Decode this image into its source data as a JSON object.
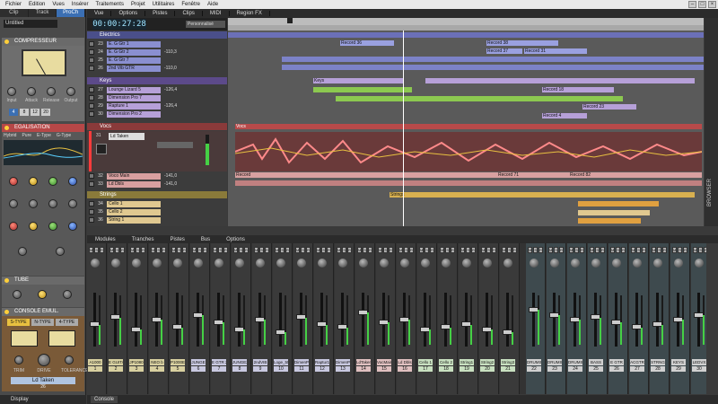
{
  "menubar": {
    "items": [
      "Fichier",
      "Edition",
      "Vues",
      "Insérer",
      "Traitements",
      "Projet",
      "Utilitaires",
      "Fenêtre",
      "Aide"
    ]
  },
  "inspector": {
    "tabs": [
      "Clip",
      "Track",
      "ProCh"
    ],
    "project_name": "Untitled",
    "compressor_title": "COMPRESSEUR",
    "compressor_knobs": [
      "Input",
      "Attack",
      "Release",
      "Output"
    ],
    "ratio_buttons": [
      "4",
      "8",
      "12",
      "20"
    ],
    "eq_title": "EGALISATION",
    "eq_modes": [
      "Hybrid",
      "Pure",
      "E-Type",
      "G-Type"
    ],
    "tube_title": "TUBE",
    "console_title": "CONSOLE EMUL.",
    "console_types": [
      "S-TYPE",
      "N-TYPE",
      "4-TYPE"
    ],
    "console_knobs": [
      "TRIM",
      "DRIVE",
      "TOLERANCE"
    ],
    "track_name": "Ld Taken",
    "track_num": "26",
    "footer": "Display"
  },
  "topmenu": [
    "Vue",
    "Options",
    "Pistes",
    "Clips",
    "MIDI",
    "Region FX"
  ],
  "timecode": "00:00:27:28",
  "view_select": "Personnalisé",
  "folders": {
    "electrics": "Electrics",
    "keys": "Keys",
    "vocs": "Vocs",
    "strings": "Strings"
  },
  "tracks": [
    {
      "num": "23",
      "name": "E. G Gtr 1",
      "vol": ""
    },
    {
      "num": "24",
      "name": "E. G Gtr 2",
      "vol": "-110,3"
    },
    {
      "num": "25",
      "name": "E. G Gtr 7",
      "vol": ""
    },
    {
      "num": "26",
      "name": "2nd Vib GTR",
      "vol": "-110,0"
    },
    {
      "num": "27",
      "name": "Lounge Lizard 5",
      "vol": "-126,4"
    },
    {
      "num": "28",
      "name": "Dimension Pro 7",
      "vol": ""
    },
    {
      "num": "29",
      "name": "Rapture 1",
      "vol": "-126,4"
    },
    {
      "num": "30",
      "name": "Dimension Pro 2",
      "vol": ""
    },
    {
      "num": "31",
      "name": "Ld Taken",
      "vol": ""
    },
    {
      "num": "32",
      "name": "Voco Main",
      "vol": "-141,0"
    },
    {
      "num": "33",
      "name": "Ld Dbls",
      "vol": "-141,0"
    },
    {
      "num": "34",
      "name": "Cello 1",
      "vol": ""
    },
    {
      "num": "35",
      "name": "Cello 2",
      "vol": ""
    },
    {
      "num": "36",
      "name": "String 1",
      "vol": ""
    }
  ],
  "clip_labels": [
    "Record 36",
    "Record 38",
    "Record 37",
    "Record 31",
    "Keys",
    "Record 18",
    "Record 23",
    "Record 4",
    "Vocs",
    "Record",
    "Strings",
    "Record 71",
    "Record 82"
  ],
  "browser_label": "BROWSER",
  "console_tabs": [
    "Modules",
    "Tranches",
    "Pistes",
    "Bus",
    "Options"
  ],
  "console_footer_tab": "Console",
  "strips": [
    {
      "label": "A1000",
      "num": "1",
      "color": "#d8d0a0",
      "lvl": 0.4
    },
    {
      "label": "E GUITAR",
      "num": "2",
      "color": "#d8d0a0",
      "lvl": 0.55
    },
    {
      "label": "JP1080",
      "num": "3",
      "color": "#d8d0a0",
      "lvl": 0.3
    },
    {
      "label": "NEO b",
      "num": "4",
      "color": "#d8d0a0",
      "lvl": 0.5
    },
    {
      "label": "P1000E",
      "num": "5",
      "color": "#d8d0a0",
      "lvl": 0.35
    },
    {
      "label": "JUNGE",
      "num": "6",
      "color": "#c8c8e0",
      "lvl": 0.6
    },
    {
      "label": "E GTR 2",
      "num": "7",
      "color": "#c8c8e0",
      "lvl": 0.45
    },
    {
      "label": "JUNGE2",
      "num": "8",
      "color": "#c8c8e0",
      "lvl": 0.3
    },
    {
      "label": "2ndVIB",
      "num": "9",
      "color": "#c8c8e0",
      "lvl": 0.5
    },
    {
      "label": "Loge_55",
      "num": "10",
      "color": "#c8c8e0",
      "lvl": 0.25
    },
    {
      "label": "DimenP",
      "num": "11",
      "color": "#c8c8e0",
      "lvl": 0.55
    },
    {
      "label": "Raptur1",
      "num": "12",
      "color": "#c8c8e0",
      "lvl": 0.4
    },
    {
      "label": "DimenP2",
      "num": "13",
      "color": "#c8c8e0",
      "lvl": 0.35
    },
    {
      "label": "LdTaken",
      "num": "14",
      "color": "#e0c0c0",
      "lvl": 0.65
    },
    {
      "label": "VocMain",
      "num": "15",
      "color": "#e0c0c0",
      "lvl": 0.45
    },
    {
      "label": "Ld Dbls",
      "num": "16",
      "color": "#e0c0c0",
      "lvl": 0.5
    },
    {
      "label": "Cello 1",
      "num": "17",
      "color": "#c8e0c0",
      "lvl": 0.3
    },
    {
      "label": "Cello 2",
      "num": "18",
      "color": "#c8e0c0",
      "lvl": 0.35
    },
    {
      "label": "String1",
      "num": "19",
      "color": "#c8e0c0",
      "lvl": 0.4
    },
    {
      "label": "String2",
      "num": "20",
      "color": "#c8e0c0",
      "lvl": 0.3
    },
    {
      "label": "String3",
      "num": "21",
      "color": "#c8e0c0",
      "lvl": 0.25
    },
    {
      "label": "DRUMS",
      "num": "22",
      "color": "#d0d0d0",
      "lvl": 0.7
    },
    {
      "label": "DRUMS",
      "num": "23",
      "color": "#d0d0d0",
      "lvl": 0.6
    },
    {
      "label": "DRUMS",
      "num": "24",
      "color": "#d0d0d0",
      "lvl": 0.5
    },
    {
      "label": "BASS",
      "num": "25",
      "color": "#d0d0d0",
      "lvl": 0.55
    },
    {
      "label": "E GTR",
      "num": "26",
      "color": "#d0d0d0",
      "lvl": 0.45
    },
    {
      "label": "ACGTR",
      "num": "27",
      "color": "#d0d0d0",
      "lvl": 0.35
    },
    {
      "label": "STRNG",
      "num": "28",
      "color": "#d0d0d0",
      "lvl": 0.4
    },
    {
      "label": "KEYS",
      "num": "29",
      "color": "#d0d0d0",
      "lvl": 0.5
    },
    {
      "label": "LEDVX",
      "num": "30",
      "color": "#d0d0d0",
      "lvl": 0.6
    }
  ],
  "colors": {
    "accent": "#3b6fb3",
    "eq_section": "#b74747",
    "selected_track": "#ff3b3b"
  }
}
